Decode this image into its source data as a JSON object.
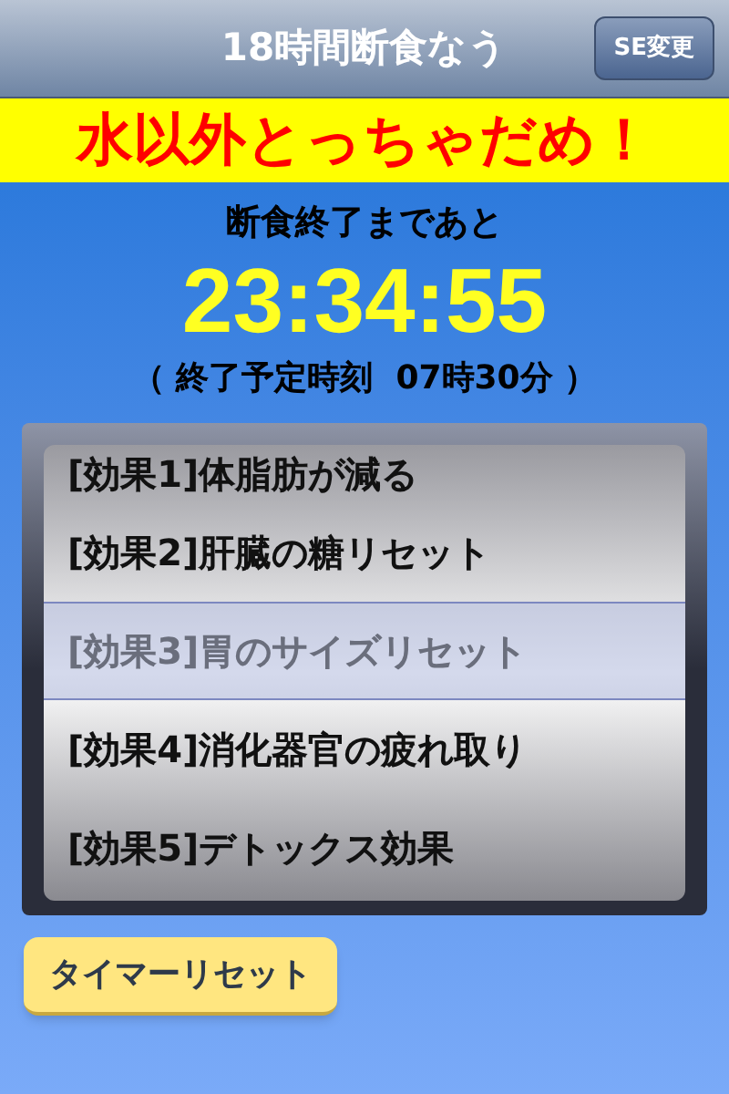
{
  "nav_bar": {
    "title": "18時間断食なう",
    "button": "SE変更"
  },
  "banner": "水以外とっちゃだめ！",
  "countdown": {
    "label": "断食終了まであと",
    "time": "23:34:55",
    "end_time": "（ 終了予定時刻  07時30分 ）"
  },
  "picker": {
    "items": [
      {
        "label": "[効果1]体脂肪が減る",
        "selected": false
      },
      {
        "label": "[効果2]肝臓の糖リセット",
        "selected": false
      },
      {
        "label": "[効果3]胃のサイズリセット",
        "selected": true
      },
      {
        "label": "[効果4]消化器官の疲れ取り",
        "selected": false
      },
      {
        "label": "[効果5]デトックス効果",
        "selected": false
      }
    ]
  },
  "reset_button": "タイマーリセット"
}
